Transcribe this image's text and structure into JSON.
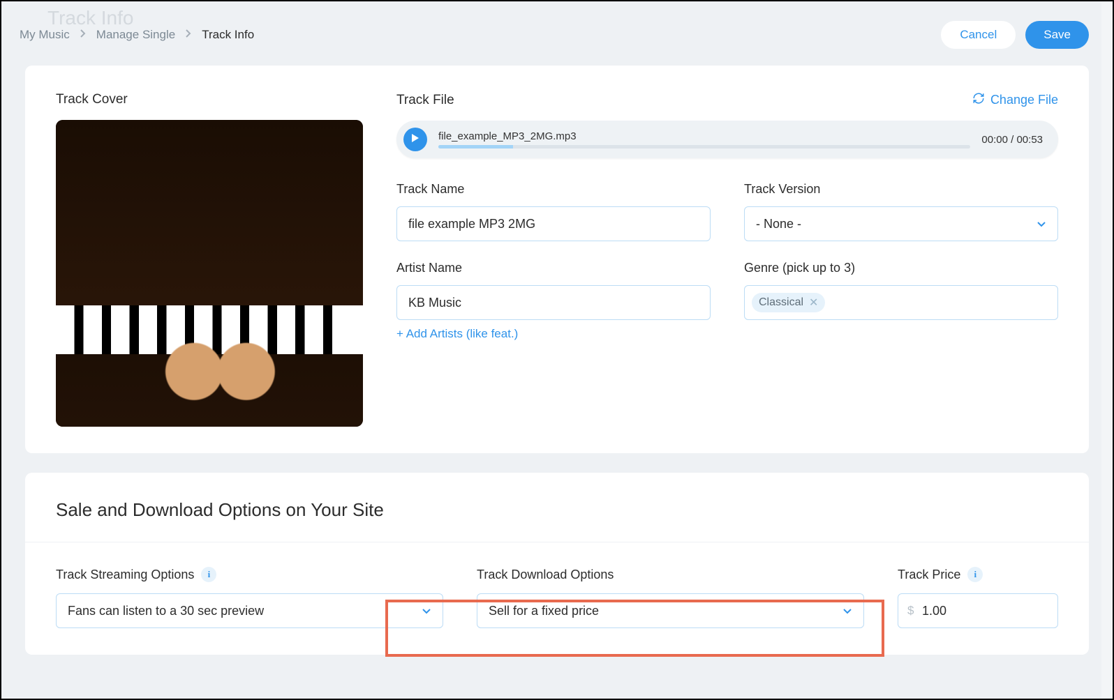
{
  "pageTitleFaded": "Track Info",
  "breadcrumb": {
    "items": [
      "My Music",
      "Manage Single"
    ],
    "current": "Track Info"
  },
  "actions": {
    "cancel": "Cancel",
    "save": "Save"
  },
  "trackCover": {
    "label": "Track Cover"
  },
  "trackFile": {
    "label": "Track File",
    "changeFile": "Change File",
    "player": {
      "filename": "file_example_MP3_2MG.mp3",
      "time": "00:00 / 00:53"
    }
  },
  "fields": {
    "trackName": {
      "label": "Track Name",
      "value": "file example MP3 2MG"
    },
    "trackVersion": {
      "label": "Track Version",
      "value": "- None -"
    },
    "artistName": {
      "label": "Artist Name",
      "value": "KB Music",
      "addLink": "+ Add Artists (like feat.)"
    },
    "genre": {
      "label": "Genre (pick up to 3)",
      "tags": [
        "Classical"
      ]
    }
  },
  "saleSection": {
    "title": "Sale and Download Options on Your Site",
    "streaming": {
      "label": "Track Streaming Options",
      "value": "Fans can listen to a 30 sec preview"
    },
    "download": {
      "label": "Track Download Options",
      "value": "Sell for a fixed price"
    },
    "price": {
      "label": "Track Price",
      "currency": "$",
      "value": "1.00"
    }
  }
}
